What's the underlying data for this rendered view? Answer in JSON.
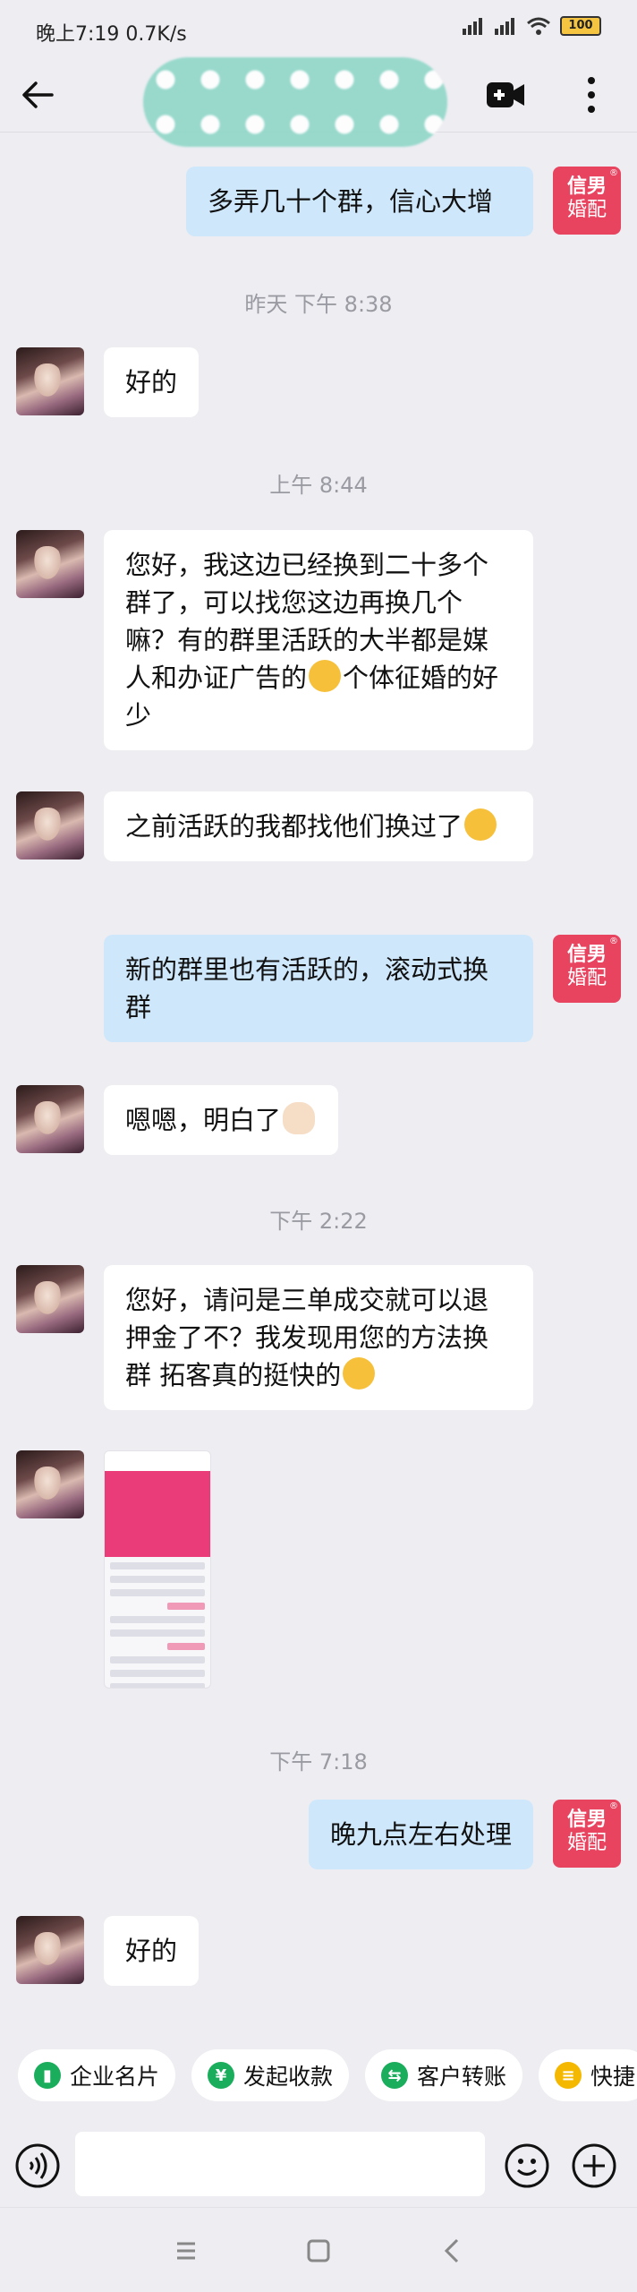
{
  "status": {
    "time": "晚上7:19",
    "speed": "0.7K/s",
    "battery": "100"
  },
  "header": {
    "contact_name": ""
  },
  "logo": {
    "line1": "信男",
    "line2": "婚配",
    "reg": "®"
  },
  "messages": {
    "m1": "多弄几十个群，信心大增",
    "t1": "昨天 下午 8:38",
    "m2": "好的",
    "t2": "上午 8:44",
    "m3a": "您好，我这边已经换到二十多个群了，可以找您这边再换几个嘛？有的群里活跃的大半都是媒人和办证广告的",
    "m3b": "个体征婚的好少",
    "m4": "之前活跃的我都找他们换过了",
    "m5": "新的群里也有活跃的，滚动式换群",
    "m6": "嗯嗯，明白了",
    "t3": "下午 2:22",
    "m7": "您好，请问是三单成交就可以退押金了不？我发现用您的方法换群 拓客真的挺快的",
    "t4": "下午 7:18",
    "m8": "晚九点左右处理",
    "m9": "好的"
  },
  "quick_actions": [
    {
      "label": "企业名片",
      "icon": "card-icon",
      "color": "#1aad5c"
    },
    {
      "label": "发起收款",
      "icon": "yen-icon",
      "color": "#1aad5c"
    },
    {
      "label": "客户转账",
      "icon": "transfer-icon",
      "color": "#1aad5c"
    },
    {
      "label": "快捷",
      "icon": "quick-icon",
      "color": "#f5b800"
    }
  ],
  "input": {
    "placeholder": ""
  }
}
